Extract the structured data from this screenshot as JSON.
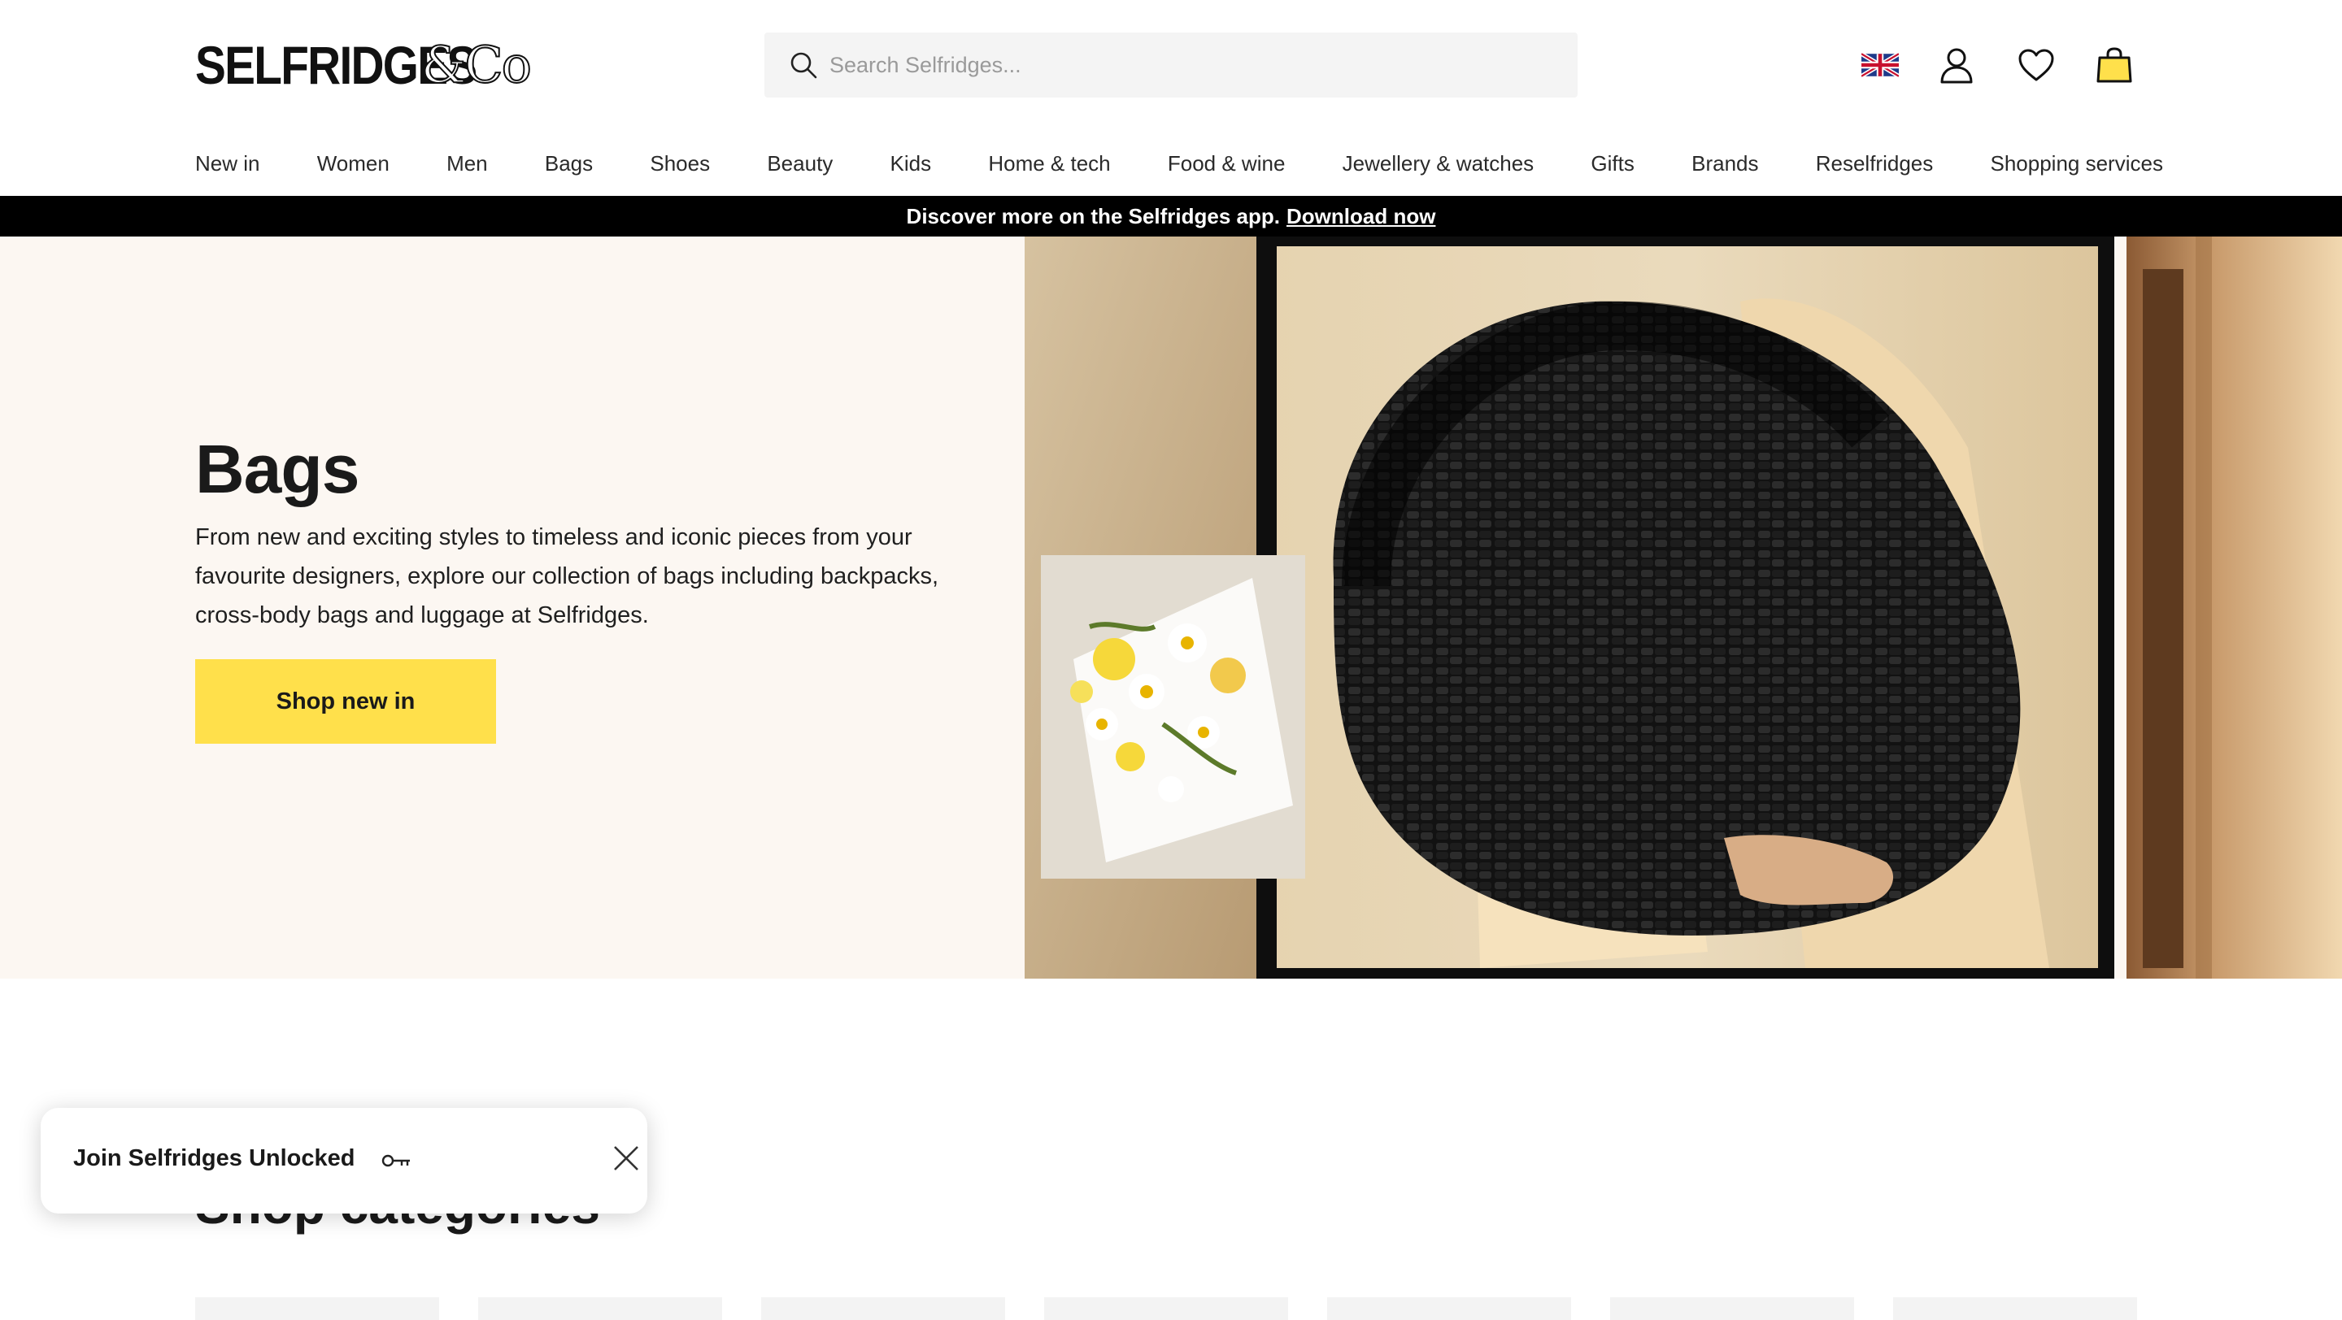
{
  "header": {
    "logo_text": "SELFRIDGES",
    "logo_suffix": "&Co",
    "search": {
      "placeholder": "Search Selfridges..."
    },
    "icons": [
      "uk-flag-icon",
      "account-icon",
      "wishlist-heart-icon",
      "shopping-bag-icon"
    ]
  },
  "nav": {
    "items": [
      "New in",
      "Women",
      "Men",
      "Bags",
      "Shoes",
      "Beauty",
      "Kids",
      "Home & tech",
      "Food & wine",
      "Jewellery & watches",
      "Gifts",
      "Brands",
      "Reselfridges",
      "Shopping services"
    ]
  },
  "app_banner": {
    "text": "Discover more on the Selfridges app.",
    "link": "Download now"
  },
  "hero": {
    "title": "Bags",
    "description": "From new and exciting styles to timeless and iconic pieces from your favourite designers, explore our collection of bags including backpacks, cross-body bags and luggage at Selfridges.",
    "button_label": "Shop new in"
  },
  "section": {
    "title": "Shop categories"
  },
  "popup": {
    "text": "Join Selfridges Unlocked"
  },
  "colors": {
    "accent_yellow": "#ffe04b",
    "banner_black": "#000000",
    "hero_bg": "#fcf7f2"
  }
}
